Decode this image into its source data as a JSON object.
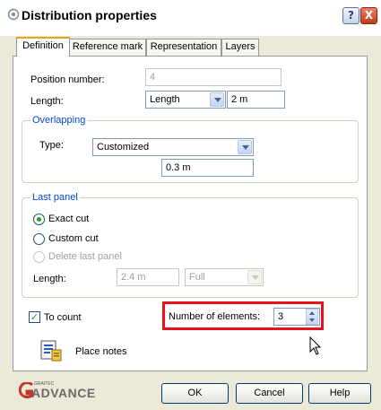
{
  "window": {
    "title": "Distribution properties",
    "help_symbol": "?",
    "close_symbol": "X"
  },
  "tabs": [
    {
      "label": "Definition",
      "active": true
    },
    {
      "label": "Reference mark"
    },
    {
      "label": "Representation"
    },
    {
      "label": "Layers"
    }
  ],
  "definition": {
    "position_number_label": "Position number:",
    "position_number_value": "4",
    "length_label": "Length:",
    "length_select_value": "Length",
    "length_value": "2 m"
  },
  "overlapping": {
    "legend": "Overlapping",
    "type_label": "Type:",
    "type_value": "Customized",
    "overlap_value": "0.3 m"
  },
  "last_panel": {
    "legend": "Last panel",
    "options": [
      {
        "label": "Exact cut",
        "checked": true
      },
      {
        "label": "Custom cut",
        "checked": false
      },
      {
        "label": "Delete last panel",
        "checked": false,
        "disabled": true
      }
    ],
    "length_label": "Length:",
    "length_value": "2.4 m",
    "mode_value": "Full"
  },
  "to_count": {
    "label": "To count",
    "checked": true
  },
  "number_of_elements": {
    "label": "Number of elements:",
    "value": "3",
    "highlight_color": "#e8121b"
  },
  "place_notes": {
    "label": "Place notes"
  },
  "footer": {
    "logo_small": "GRAITEC",
    "logo_text": "ADVANCE",
    "ok_label": "OK",
    "cancel_label": "Cancel",
    "help_label": "Help"
  },
  "colors": {
    "accent": "#0046d5",
    "title_bg": "#ffffff",
    "dialog_bg": "#ece9d8",
    "highlight": "#e8121b"
  }
}
